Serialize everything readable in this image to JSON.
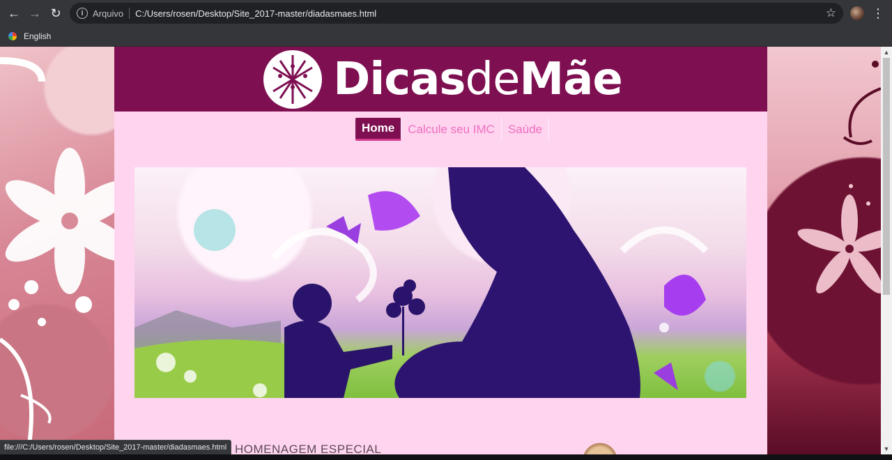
{
  "browser": {
    "scheme_label": "Arquivo",
    "url": "C:/Users/rosen/Desktop/Site_2017-master/diadasmaes.html",
    "back_icon": "arrow-left-icon",
    "forward_icon": "arrow-right-icon",
    "reload_icon": "reload-icon",
    "bookmark_icon": "star-icon",
    "menu_icon": "kebab-menu-icon"
  },
  "bookmarks": [
    {
      "label": "English"
    }
  ],
  "site": {
    "logo": {
      "bold1": "Dicas",
      "light": "de",
      "bold2": "Mãe"
    },
    "nav": [
      {
        "label": "Home",
        "active": true
      },
      {
        "label": "Calcule seu IMC",
        "active": false
      },
      {
        "label": "Saúde",
        "active": false
      }
    ],
    "section_title": "HOMENAGEM ESPECIAL",
    "colors": {
      "header": "#7e0f51",
      "page_bg": "#ffd4ef",
      "nav_link": "#ee6fbf",
      "nav_active_bg": "#7e0f51"
    }
  },
  "status_bar": {
    "text": "file:///C:/Users/rosen/Desktop/Site_2017-master/diadasmaes.html"
  }
}
